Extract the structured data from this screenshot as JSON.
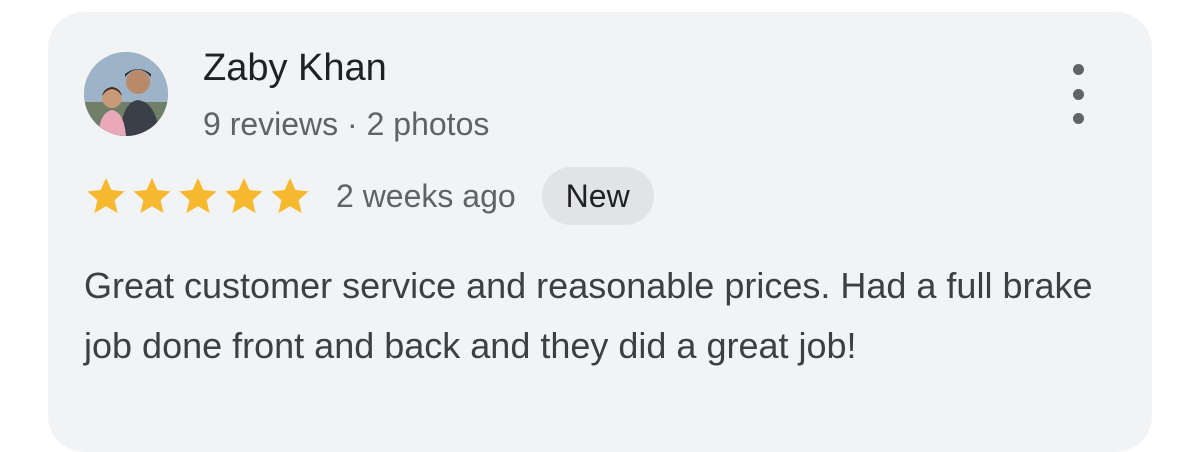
{
  "review": {
    "reviewer_name": "Zaby Khan",
    "reviewer_meta": "9 reviews · 2 photos",
    "rating": 5,
    "rating_max": 5,
    "time_ago": "2 weeks ago",
    "badge": "New",
    "text": "Great customer service and reasonable prices. Had a full brake job done front and back and they did a great job!"
  },
  "icons": {
    "avatar": "reviewer-avatar-photo",
    "more": "more-vert-icon",
    "star": "star-icon"
  },
  "colors": {
    "card_background": "#f2f3f5",
    "star": "#f5b82e",
    "name_text": "#202124",
    "secondary_text": "#5f6368",
    "badge_background": "#e1e3e6"
  }
}
